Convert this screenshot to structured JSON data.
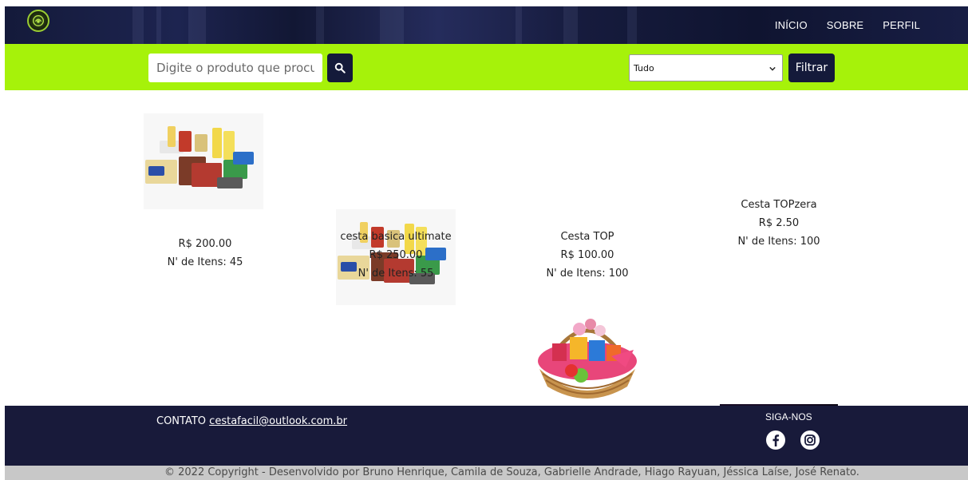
{
  "header": {
    "logo_alt": "Cesta Fácil logo",
    "nav": [
      "INÍCIO",
      "SOBRE",
      "PERFIL"
    ]
  },
  "search": {
    "placeholder": "Digite o produto que procura",
    "button_icon": "search-icon"
  },
  "filter": {
    "selected": "Tudo",
    "button_label": "Filtrar"
  },
  "products": [
    {
      "name": "",
      "price": "R$ 200.00",
      "items": "N' de Itens: 45",
      "image": "grocery-basket-image"
    },
    {
      "name": "cesta basica ultimate",
      "price": "R$ 250.00",
      "items": "N' de Itens: 55",
      "image": "grocery-basket-image"
    },
    {
      "name": "Cesta TOP",
      "price": "R$ 100.00",
      "items": "N' de Itens: 100",
      "image": "gift-basket-image"
    },
    {
      "name": "Cesta TOPzera",
      "price": "R$ 2.50",
      "items": "N' de Itens: 100",
      "image": "abstract-purple-image"
    }
  ],
  "footer": {
    "contact_label": "CONTATO",
    "contact_email": "cestafacil@outlook.com.br",
    "follow_label": "SIGA-NOS",
    "social": [
      "facebook-icon",
      "instagram-icon"
    ],
    "copyright": "© 2022 Copyright - Desenvolvido por Bruno Henrique, Camila de Souza, Gabrielle Andrade, Hiago Rayuan, Jéssica Laíse, José Renato."
  },
  "colors": {
    "nav_dark": "#141a3a",
    "accent_green": "#a6f20a",
    "footer_dark": "#181a3a"
  }
}
